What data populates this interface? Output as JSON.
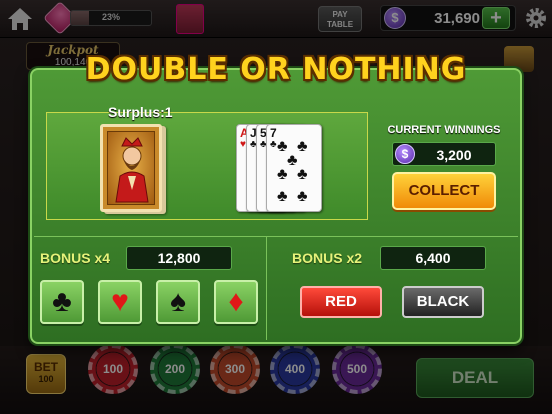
{
  "topbar": {
    "level": "",
    "xp_percent_text": "23%",
    "xp_fraction": 0.23,
    "paytable_line1": "PAY",
    "paytable_line2": "TABLE",
    "coins": "31,690",
    "plus_label": "+"
  },
  "background": {
    "jackpot_title": "Jackpot",
    "jackpot_value": "100,140",
    "bet_label": "BET",
    "bet_value": "100",
    "chips": [
      {
        "label": "100",
        "color": "#c0202a"
      },
      {
        "label": "200",
        "color": "#1f7a3a"
      },
      {
        "label": "300",
        "color": "#c24a2a"
      },
      {
        "label": "400",
        "color": "#2a3aa0"
      },
      {
        "label": "500",
        "color": "#6a2a9a"
      }
    ],
    "deal_label": "DEAL"
  },
  "dialog": {
    "title": "DOUBLE OR NOTHING",
    "surplus": "Surplus:1",
    "cards": [
      {
        "rank": "A",
        "suit": "♥",
        "color": "#d01818"
      },
      {
        "rank": "J",
        "suit": "♣",
        "color": "#111111"
      },
      {
        "rank": "5",
        "suit": "♣",
        "color": "#111111"
      },
      {
        "rank": "7",
        "suit": "♣",
        "color": "#111111"
      }
    ],
    "current_winnings_label": "CURRENT WINNINGS",
    "current_winnings_value": "3,200",
    "collect_label": "COLLECT",
    "bonus_suit_label": "BONUS x4",
    "bonus_suit_value": "12,800",
    "bonus_color_label": "BONUS x2",
    "bonus_color_value": "6,400",
    "suits": [
      {
        "glyph": "♣",
        "color": "#111111"
      },
      {
        "glyph": "♥",
        "color": "#e01818"
      },
      {
        "glyph": "♠",
        "color": "#111111"
      },
      {
        "glyph": "♦",
        "color": "#e01818"
      }
    ],
    "red_label": "RED",
    "black_label": "BLACK"
  },
  "colors": {
    "dialog_green": "#4f9a36",
    "title_gold": "#ffd21e",
    "collect_orange": "#f5a416",
    "bonus_text": "#e6f27a"
  }
}
